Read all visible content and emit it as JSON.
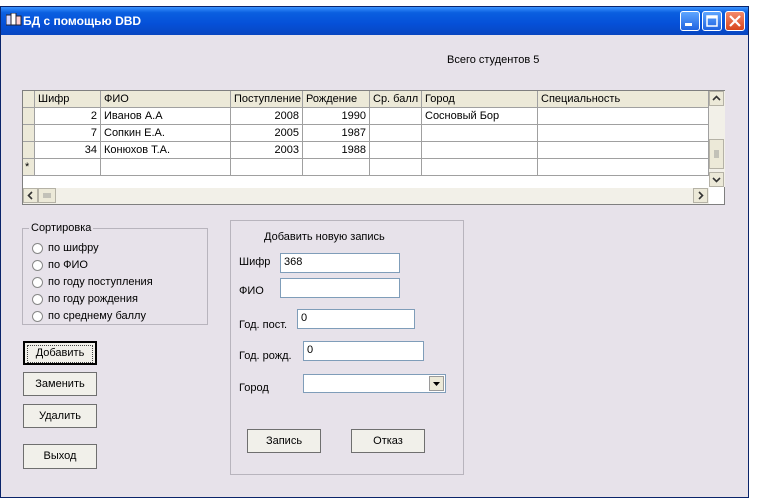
{
  "window": {
    "title": "БД с помощью DBD"
  },
  "counter": {
    "text": "Всего студентов 5"
  },
  "grid": {
    "columns": [
      "Шифр",
      "ФИО",
      "Поступление",
      "Рождение",
      "Ср. балл",
      "Город",
      "Специальность"
    ],
    "rows": [
      [
        "2",
        "Иванов А.А",
        "2008",
        "1990",
        "",
        "Сосновый Бор",
        ""
      ],
      [
        "7",
        "Сопкин Е.А.",
        "2005",
        "1987",
        "",
        "",
        ""
      ],
      [
        "34",
        "Конюхов Т.А.",
        "2003",
        "1988",
        "",
        "",
        ""
      ]
    ],
    "new_row_marker": "*"
  },
  "sort": {
    "legend": "Сортировка",
    "options": [
      "по шифру",
      "по ФИО",
      "по году поступления",
      "по году рождения",
      "по среднему баллу"
    ]
  },
  "buttons": {
    "add": "Добавить",
    "replace": "Заменить",
    "delete": "Удалить",
    "exit": "Выход"
  },
  "form": {
    "title": "Добавить новую запись",
    "code_label": "Шифр",
    "code_value": "368",
    "name_label": "ФИО",
    "name_value": "",
    "entry_label": "Год. пост.",
    "entry_value": "0",
    "birth_label": "Год. рожд.",
    "birth_value": "0",
    "city_label": "Город",
    "city_value": "",
    "save_label": "Запись",
    "cancel_label": "Отказ"
  },
  "colors": {
    "title_bar": "#0550d8",
    "window_bg": "#e7e2ea",
    "close_button": "#d8461e"
  }
}
